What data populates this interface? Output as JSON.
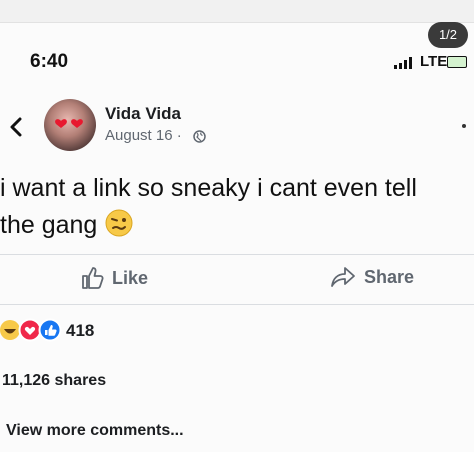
{
  "viewer": {
    "pager": "1/2"
  },
  "status_bar": {
    "time": "6:40",
    "network": "LTE"
  },
  "post": {
    "author": "Vida Vida",
    "date": "August 16 ·",
    "text_line1": "i want a link so sneaky i cant even tell",
    "text_line2": "the gang",
    "emoji": "woozy-face"
  },
  "actions": {
    "like_label": "Like",
    "share_label": "Share"
  },
  "stats": {
    "reaction_count": "418",
    "reactions": [
      "haha",
      "love",
      "like"
    ],
    "shares": "11,126 shares"
  },
  "comments": {
    "view_more": "View more comments..."
  },
  "colors": {
    "like_blue": "#1877f2",
    "love_red": "#f0284a",
    "haha_yellow": "#f7c948",
    "secondary_text": "#606770"
  }
}
